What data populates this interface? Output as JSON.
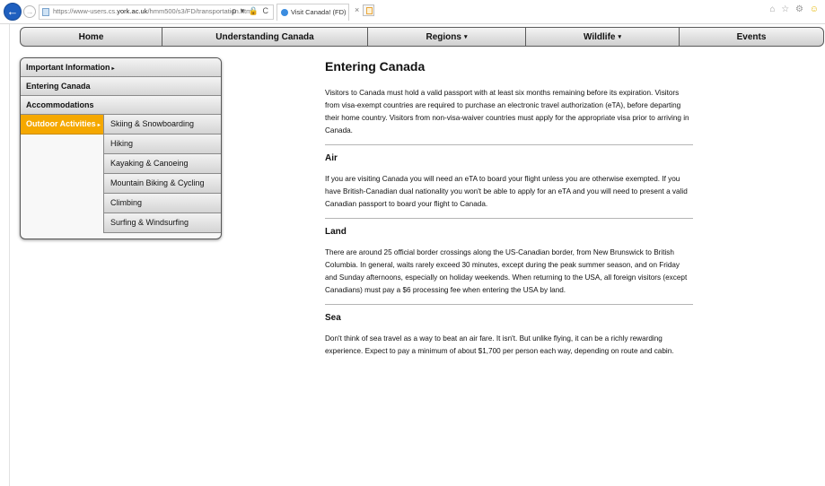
{
  "browser": {
    "url_prefix": "https://www-users.cs.",
    "url_domain": "york.ac.uk",
    "url_suffix": "/hmm500/s3/FD/transportation.html",
    "addr_tools": "ρ ▾ 🔒 C",
    "tab_title": "Visit Canada! (FD)",
    "tab_close": "×",
    "back_glyph": "←",
    "forward_glyph": "→",
    "right_icons": [
      "⌂",
      "☆",
      "⚙",
      "☺"
    ],
    "icons": [
      "back-arrow-icon",
      "forward-arrow-icon",
      "page-icon",
      "search-icon",
      "lock-icon",
      "refresh-icon",
      "favicon-icon",
      "new-tab-icon",
      "home-icon",
      "favorites-star-icon",
      "settings-gear-icon",
      "smiley-icon"
    ]
  },
  "topnav": {
    "items": [
      {
        "label": "Home",
        "dropdown": ""
      },
      {
        "label": "Understanding Canada",
        "dropdown": ""
      },
      {
        "label": "Regions",
        "dropdown": "▾"
      },
      {
        "label": "Wildlife",
        "dropdown": "▾"
      },
      {
        "label": "Events",
        "dropdown": ""
      }
    ]
  },
  "sidebar": {
    "items": [
      {
        "label": "Important Information",
        "caret": "▸"
      },
      {
        "label": "Entering Canada",
        "caret": ""
      },
      {
        "label": "Accommodations",
        "caret": ""
      },
      {
        "label": "Outdoor Activities",
        "caret": "▸"
      }
    ],
    "subitems": [
      {
        "label": "Skiing & Snowboarding"
      },
      {
        "label": "Hiking"
      },
      {
        "label": "Kayaking & Canoeing"
      },
      {
        "label": "Mountain Biking & Cycling"
      },
      {
        "label": "Climbing"
      },
      {
        "label": "Surfing & Windsurfing"
      }
    ],
    "active_color": "#f5a800"
  },
  "main": {
    "title": "Entering Canada",
    "intro": "Visitors to Canada must hold a valid passport with at least six months remaining before its expiration. Visitors from visa-exempt countries are required to purchase an electronic travel authorization (eTA), before departing their home country. Visitors from non-visa-waiver countries must apply for the appropriate visa prior to arriving in Canada.",
    "sections": [
      {
        "heading": "Air",
        "text": "If you are visiting Canada you will need an eTA to board your flight unless you are otherwise exempted. If you have British-Canadian dual nationality you won't be able to apply for an eTA and you will need to present a valid Canadian passport to board your flight to Canada."
      },
      {
        "heading": "Land",
        "text": "There are around 25 official border crossings along the US-Canadian border, from New Brunswick to British Columbia. In general, waits rarely exceed 30 minutes, except during the peak summer season, and on Friday and Sunday afternoons, especially on holiday weekends. When returning to the USA, all foreign visitors (except Canadians) must pay a $6 processing fee when entering the USA by land."
      },
      {
        "heading": "Sea",
        "text": "Don't think of sea travel as a way to beat an air fare. It isn't. But unlike flying, it can be a richly rewarding experience. Expect to pay a minimum of about $1,700 per person each way, depending on route and cabin."
      }
    ]
  }
}
